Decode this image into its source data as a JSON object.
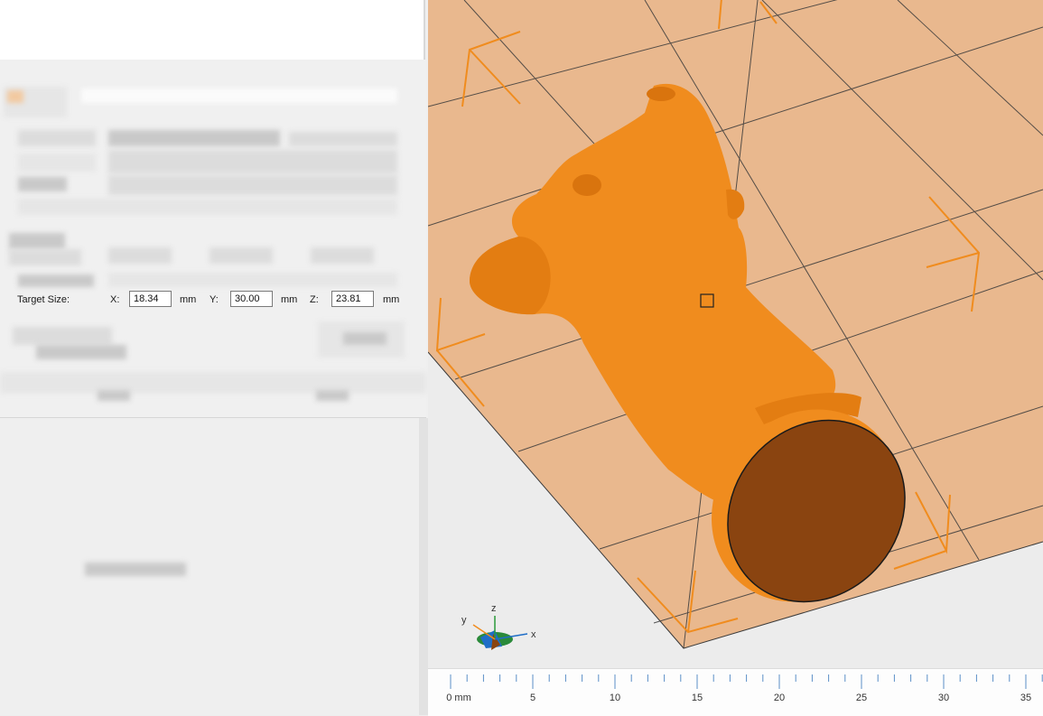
{
  "dialog": {
    "target_size": {
      "label": "Target Size:",
      "x_label": "X:",
      "x_value": "18.34",
      "y_label": "Y:",
      "y_value": "30.00",
      "z_label": "Z:",
      "z_value": "23.81",
      "unit": "mm"
    }
  },
  "viewport": {
    "model_color": "#f08c1e",
    "bed_color": "#e9b88e",
    "axes": {
      "x": "x",
      "y": "y",
      "z": "z"
    }
  },
  "ruler": {
    "labels": [
      "0 mm",
      "5",
      "10",
      "15",
      "20",
      "25",
      "30",
      "35"
    ]
  }
}
